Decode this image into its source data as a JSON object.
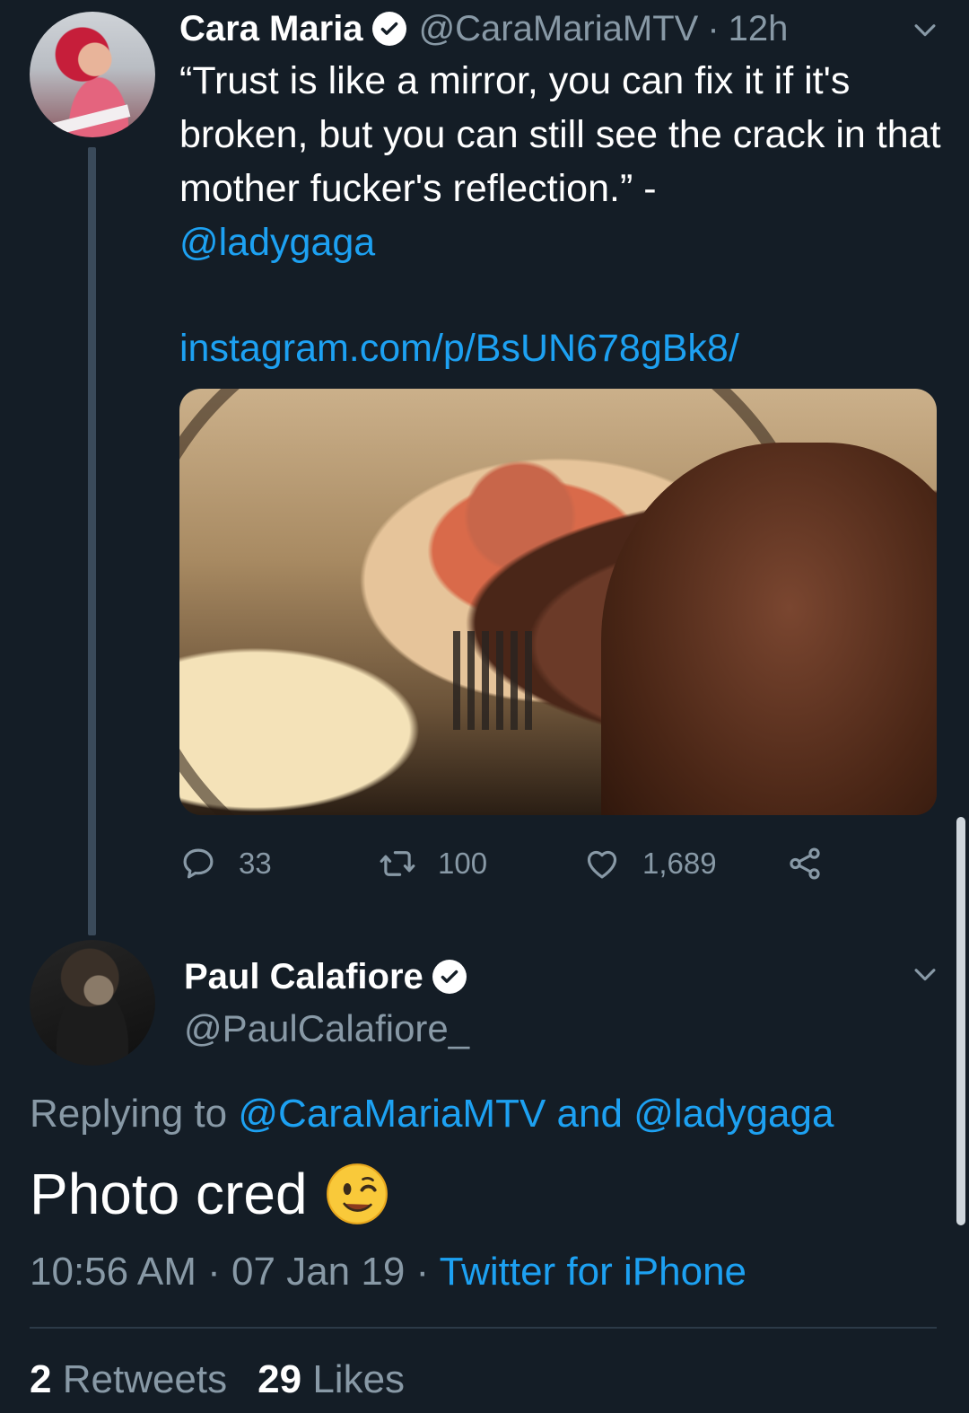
{
  "parent_tweet": {
    "display_name": "Cara Maria",
    "handle": "@CaraMariaMTV",
    "separator": "·",
    "time": "12h",
    "text_before_mention": "“Trust is like a mirror, you can fix it if it's broken, but you can still see the crack in that mother fucker's reflection.” -",
    "mention": "@ladygaga",
    "url": "instagram.com/p/BsUN678gBk8/",
    "reply_count": "33",
    "retweet_count": "100",
    "like_count": "1,689"
  },
  "reply_tweet": {
    "display_name": "Paul Calafiore",
    "handle": "@PaulCalafiore_",
    "replying_to_label": "Replying to",
    "replying_to_user_1": "@CaraMariaMTV",
    "replying_to_and": "and",
    "replying_to_user_2": "@ladygaga",
    "text": "Photo cred",
    "time": "10:56 AM",
    "separator": "·",
    "date": "07 Jan 19",
    "source": "Twitter for iPhone",
    "retweets_count": "2",
    "retweets_label": "Retweets",
    "likes_count": "29",
    "likes_label": "Likes"
  },
  "icons": {
    "verified": "verified-badge-icon",
    "chevron": "chevron-down-icon",
    "reply": "reply-icon",
    "retweet": "retweet-icon",
    "like": "heart-icon",
    "share": "share-icon",
    "emoji": "winking-face-emoji"
  },
  "colors": {
    "background": "#141d26",
    "link": "#1da1f2",
    "secondary_text": "#8899a6",
    "primary_text": "#ffffff"
  }
}
